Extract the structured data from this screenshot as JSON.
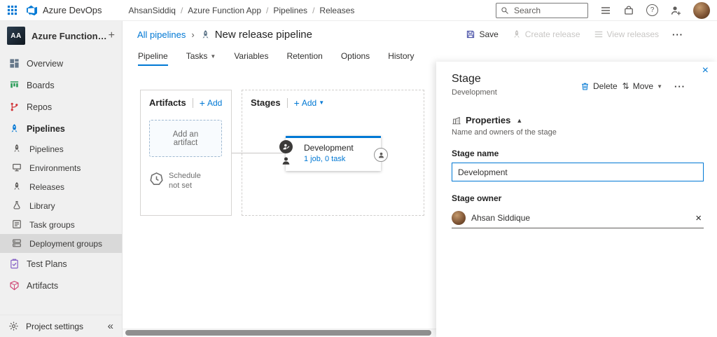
{
  "topbar": {
    "brand": "Azure DevOps",
    "breadcrumb": [
      "AhsanSiddiq",
      "Azure Function App",
      "Pipelines",
      "Releases"
    ],
    "search": {
      "placeholder": "Search"
    }
  },
  "sidebar": {
    "project_name": "Azure Function App",
    "project_initials": "AA",
    "items": [
      {
        "label": "Overview",
        "icon": "overview-icon"
      },
      {
        "label": "Boards",
        "icon": "boards-icon"
      },
      {
        "label": "Repos",
        "icon": "repos-icon"
      },
      {
        "label": "Pipelines",
        "icon": "pipelines-icon"
      },
      {
        "label": "Pipelines",
        "icon": "pipelines-icon"
      },
      {
        "label": "Environments",
        "icon": "environments-icon"
      },
      {
        "label": "Releases",
        "icon": "releases-icon"
      },
      {
        "label": "Library",
        "icon": "library-icon"
      },
      {
        "label": "Task groups",
        "icon": "task-groups-icon"
      },
      {
        "label": "Deployment groups",
        "icon": "deployment-groups-icon"
      },
      {
        "label": "Test Plans",
        "icon": "test-plans-icon"
      },
      {
        "label": "Artifacts",
        "icon": "artifacts-icon"
      }
    ],
    "footer_label": "Project settings"
  },
  "page": {
    "breadcrumb_link": "All pipelines",
    "title": "New release pipeline",
    "save_label": "Save",
    "create_release_label": "Create release",
    "view_releases_label": "View releases",
    "active_tab": "Pipeline",
    "tabs": [
      {
        "label": "Pipeline"
      },
      {
        "label": "Tasks"
      },
      {
        "label": "Variables"
      },
      {
        "label": "Retention"
      },
      {
        "label": "Options"
      },
      {
        "label": "History"
      }
    ]
  },
  "canvas": {
    "artifacts": {
      "title": "Artifacts",
      "add_label": "Add",
      "placeholder_label": "Add an artifact",
      "schedule_label": "Schedule not set"
    },
    "stages": {
      "title": "Stages",
      "add_label": "Add",
      "stage": {
        "name": "Development",
        "meta": "1 job, 0 task"
      }
    }
  },
  "panel": {
    "title": "Stage",
    "subtitle": "Development",
    "delete_label": "Delete",
    "move_label": "Move",
    "properties_title": "Properties",
    "properties_description": "Name and owners of the stage",
    "stage_name_label": "Stage name",
    "stage_name_value": "Development",
    "stage_owner_label": "Stage owner",
    "stage_owner_value": "Ahsan Siddique"
  },
  "colors": {
    "accent": "#0078d4",
    "disabled": "#c8c6c4",
    "sidebar_bg": "#f0f0f0"
  }
}
